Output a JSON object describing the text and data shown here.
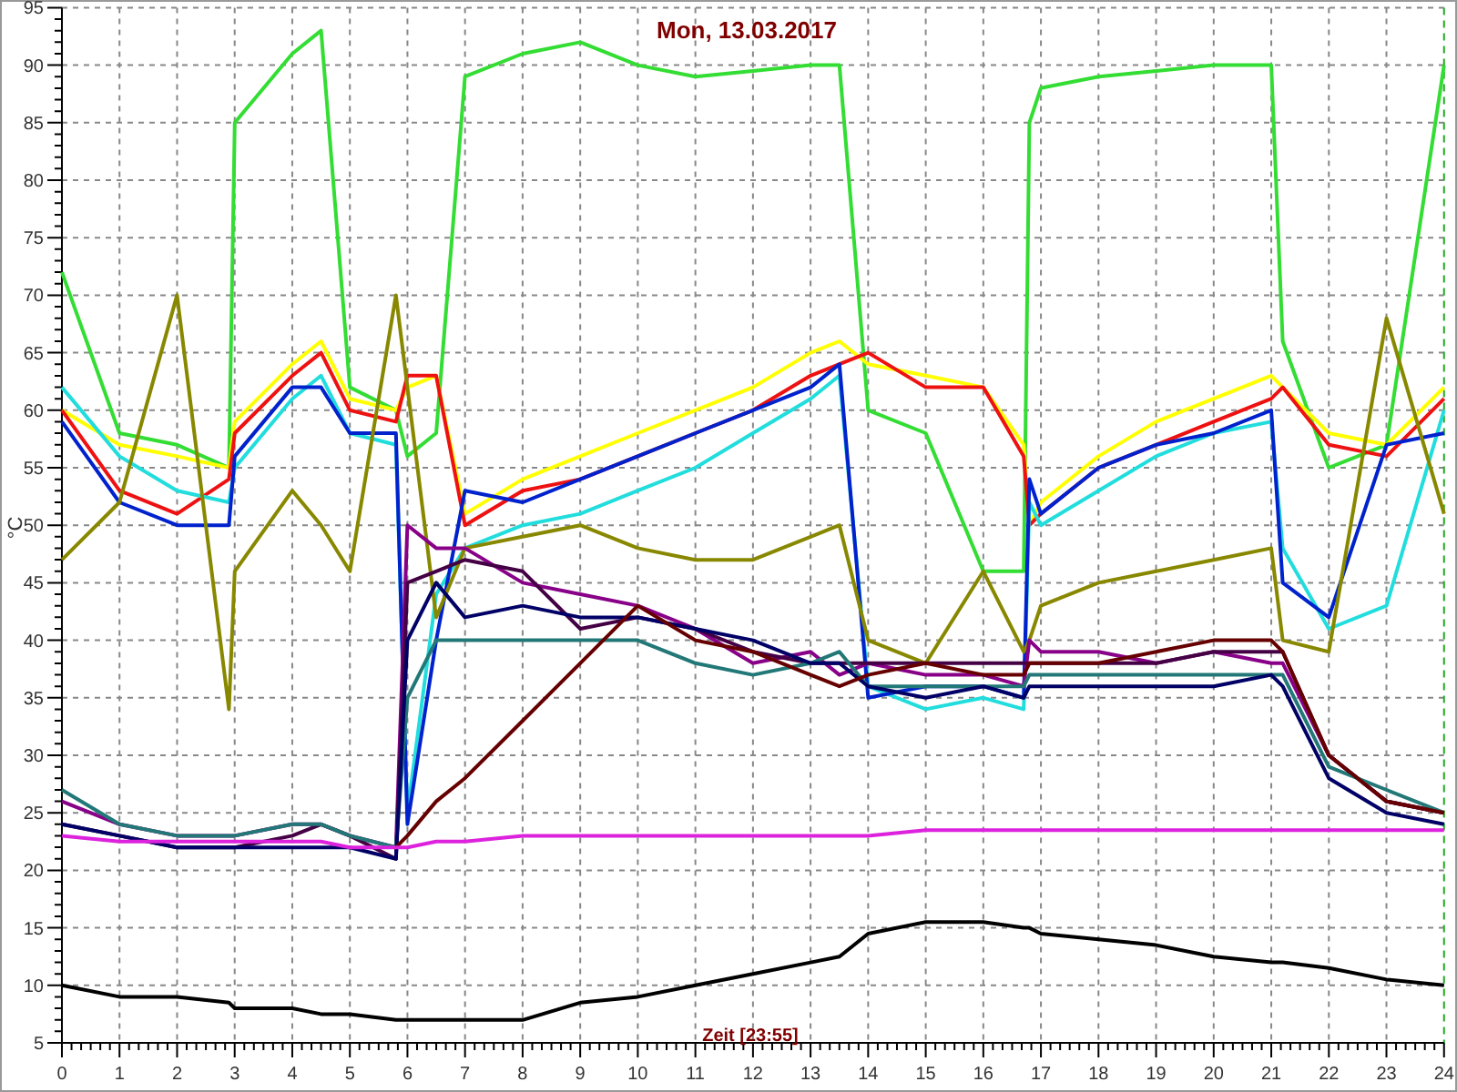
{
  "chart_data": {
    "type": "line",
    "title": "Mon, 13.03.2017",
    "xlabel": "Zeit [23:55]",
    "ylabel": "°C",
    "xlim": [
      0,
      24
    ],
    "ylim": [
      5,
      95
    ],
    "grid": true,
    "xticks": [
      0,
      1,
      2,
      3,
      4,
      5,
      6,
      7,
      8,
      9,
      10,
      11,
      12,
      13,
      14,
      15,
      16,
      17,
      18,
      19,
      20,
      21,
      22,
      23,
      24
    ],
    "yticks": [
      5,
      10,
      15,
      20,
      25,
      30,
      35,
      40,
      45,
      50,
      55,
      60,
      65,
      70,
      75,
      80,
      85,
      90,
      95
    ],
    "x": [
      0,
      1,
      2,
      2.9,
      3,
      4,
      4.5,
      5,
      5.8,
      6,
      6.5,
      7,
      8,
      9,
      10,
      11,
      12,
      13,
      13.5,
      14,
      15,
      16,
      16.7,
      16.8,
      17,
      18,
      19,
      20,
      21,
      21.2,
      22,
      23,
      24
    ],
    "series": [
      {
        "color": "#33dd33",
        "values": [
          72,
          58,
          57,
          55,
          85,
          91,
          93,
          62,
          60,
          56,
          58,
          89,
          91,
          92,
          90,
          89,
          89.5,
          90,
          90,
          60,
          58,
          46,
          46,
          85,
          88,
          89,
          89.5,
          90,
          90,
          66,
          55,
          57,
          90
        ]
      },
      {
        "color": "#ffff00",
        "values": [
          60,
          57,
          56,
          55,
          59,
          64,
          66,
          61,
          60,
          62,
          63,
          51,
          54,
          56,
          58,
          60,
          62,
          65,
          66,
          64,
          63,
          62,
          57,
          50,
          52,
          56,
          59,
          61,
          63,
          62,
          58,
          57,
          62
        ]
      },
      {
        "color": "#ee1111",
        "values": [
          60,
          53,
          51,
          54,
          58,
          63,
          65,
          60,
          59,
          63,
          63,
          50,
          53,
          54,
          56,
          58,
          60,
          63,
          64,
          65,
          62,
          62,
          56,
          50,
          51,
          55,
          57,
          59,
          61,
          62,
          57,
          56,
          61
        ]
      },
      {
        "color": "#22dddd",
        "values": [
          62,
          56,
          53,
          52,
          55,
          61,
          63,
          58,
          57,
          25,
          44,
          48,
          50,
          51,
          53,
          55,
          58,
          61,
          63,
          36,
          34,
          35,
          34,
          52,
          50,
          53,
          56,
          58,
          59,
          48,
          41,
          43,
          60
        ]
      },
      {
        "color": "#0022cc",
        "values": [
          59,
          52,
          50,
          50,
          56,
          62,
          62,
          58,
          58,
          24,
          40,
          53,
          52,
          54,
          56,
          58,
          60,
          62,
          64,
          35,
          36,
          36,
          35,
          54,
          51,
          55,
          57,
          58,
          60,
          45,
          42,
          57,
          58
        ]
      },
      {
        "color": "#888800",
        "values": [
          47,
          52,
          70,
          34,
          46,
          53,
          50,
          46,
          70,
          62,
          42,
          48,
          49,
          50,
          48,
          47,
          47,
          49,
          50,
          40,
          38,
          46,
          39,
          40,
          43,
          45,
          46,
          47,
          48,
          40,
          39,
          68,
          51
        ]
      },
      {
        "color": "#880088",
        "values": [
          26,
          24,
          23,
          23,
          23,
          24,
          24,
          23,
          22,
          50,
          48,
          48,
          45,
          44,
          43,
          41,
          38,
          39,
          37,
          38,
          37,
          37,
          36,
          40,
          39,
          39,
          38,
          39,
          38,
          38,
          30,
          26,
          25
        ]
      },
      {
        "color": "#440044",
        "values": [
          24,
          23,
          22,
          22,
          22,
          23,
          24,
          23,
          21,
          45,
          46,
          47,
          46,
          41,
          42,
          41,
          39,
          38,
          38,
          38,
          38,
          38,
          38,
          38,
          38,
          38,
          38,
          39,
          39,
          39,
          30,
          26,
          25
        ]
      },
      {
        "color": "#227777",
        "values": [
          27,
          24,
          23,
          23,
          23,
          24,
          24,
          23,
          22,
          35,
          40,
          40,
          40,
          40,
          40,
          38,
          37,
          38,
          39,
          36,
          36,
          36,
          36,
          37,
          37,
          37,
          37,
          37,
          37,
          37,
          29,
          27,
          25
        ]
      },
      {
        "color": "#000066",
        "values": [
          24,
          23,
          22,
          22,
          22,
          22,
          22,
          22,
          21,
          40,
          45,
          42,
          43,
          42,
          42,
          41,
          40,
          38,
          38,
          36,
          35,
          36,
          35,
          36,
          36,
          36,
          36,
          36,
          37,
          36,
          28,
          25,
          24
        ]
      },
      {
        "color": "#660000",
        "values": [
          null,
          null,
          null,
          null,
          null,
          null,
          null,
          null,
          22,
          23,
          26,
          28,
          33,
          38,
          43,
          40,
          39,
          37,
          36,
          37,
          38,
          37,
          37,
          38,
          38,
          38,
          39,
          40,
          40,
          39,
          30,
          26,
          25
        ]
      },
      {
        "color": "#dd22dd",
        "values": [
          23,
          22.5,
          22.5,
          22.5,
          22.5,
          22.5,
          22.5,
          22,
          22,
          22,
          22.5,
          22.5,
          23,
          23,
          23,
          23,
          23,
          23,
          23,
          23,
          23.5,
          23.5,
          23.5,
          23.5,
          23.5,
          23.5,
          23.5,
          23.5,
          23.5,
          23.5,
          23.5,
          23.5,
          23.5
        ]
      },
      {
        "color": "#000000",
        "values": [
          10,
          9,
          9,
          8.5,
          8,
          8,
          7.5,
          7.5,
          7,
          7,
          7,
          7,
          7,
          8.5,
          9,
          10,
          11,
          12,
          12.5,
          14.5,
          15.5,
          15.5,
          15,
          15,
          14.5,
          14,
          13.5,
          12.5,
          12,
          12,
          11.5,
          10.5,
          10
        ]
      }
    ]
  }
}
